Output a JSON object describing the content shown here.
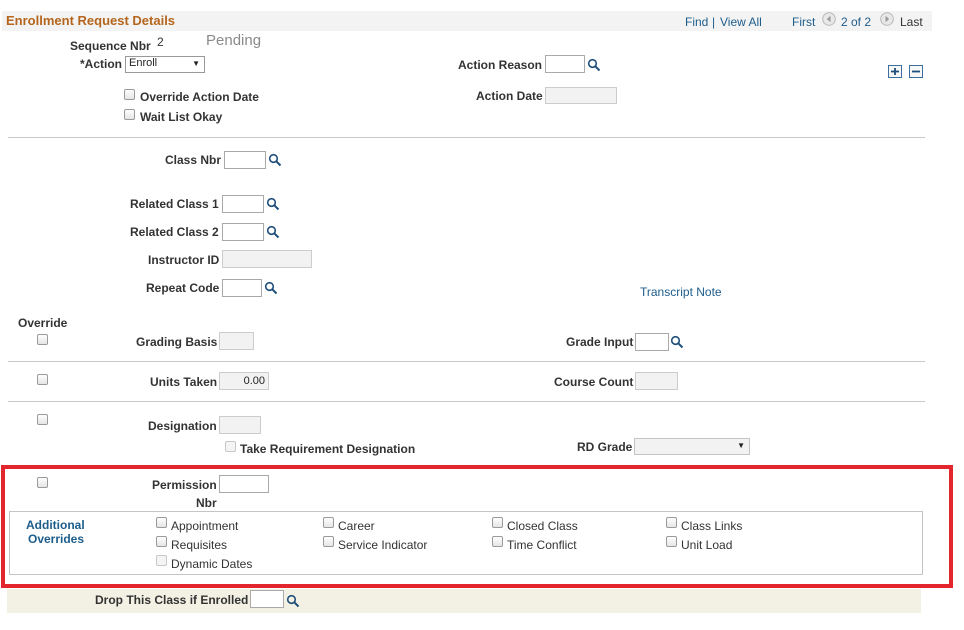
{
  "header": {
    "title": "Enrollment Request Details",
    "find": "Find",
    "separator": "|",
    "view_all": "View All",
    "first": "First",
    "page_info": "2 of 2",
    "last": "Last"
  },
  "row1": {
    "sequence_label": "Sequence Nbr",
    "sequence_value": "2",
    "status": "Pending",
    "action_label": "*Action",
    "action_value": "Enroll",
    "action_reason_label": "Action Reason",
    "action_reason_value": "",
    "action_date_label": "Action Date",
    "action_date_value": "",
    "override_action_date": "Override Action Date",
    "wait_list_okay": "Wait List Okay"
  },
  "class": {
    "class_nbr_label": "Class Nbr",
    "class_nbr_value": "",
    "related1_label": "Related Class 1",
    "related1_value": "",
    "related2_label": "Related Class 2",
    "related2_value": "",
    "instructor_label": "Instructor ID",
    "instructor_value": "",
    "repeat_label": "Repeat Code",
    "repeat_value": "",
    "transcript_note": "Transcript Note"
  },
  "override": {
    "override_label": "Override",
    "grading_basis_label": "Grading Basis",
    "grading_basis_value": "",
    "grade_input_label": "Grade Input",
    "grade_input_value": "",
    "units_taken_label": "Units Taken",
    "units_taken_value": "0.00",
    "course_count_label": "Course Count",
    "course_count_value": "",
    "designation_label": "Designation",
    "designation_value": "",
    "take_req_designation": "Take Requirement Designation",
    "rd_grade_label": "RD Grade",
    "rd_grade_value": ""
  },
  "permission": {
    "permission_label_1": "Permission",
    "permission_label_2": "Nbr",
    "permission_value": "",
    "additional_overrides_1": "Additional",
    "additional_overrides_2": "Overrides",
    "checkboxes": {
      "appointment": "Appointment",
      "career": "Career",
      "closed_class": "Closed Class",
      "class_links": "Class Links",
      "requisites": "Requisites",
      "service_indicator": "Service Indicator",
      "time_conflict": "Time Conflict",
      "unit_load": "Unit Load",
      "dynamic_dates": "Dynamic Dates"
    }
  },
  "footer": {
    "drop_label": "Drop This Class if Enrolled",
    "drop_value": ""
  },
  "colors": {
    "title": "#b5651d",
    "link": "#1d5d8c",
    "highlight_border": "#e3262d",
    "footer_bg": "#f2f1e4"
  }
}
